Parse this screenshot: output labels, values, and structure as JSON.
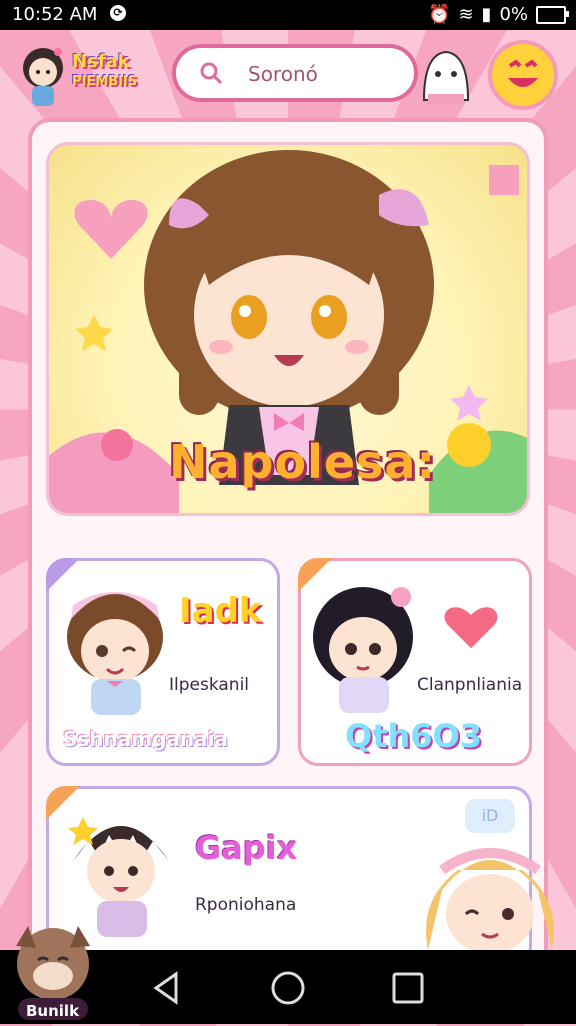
{
  "status_bar": {
    "time": "10:52 AM",
    "battery": "0%"
  },
  "header": {
    "logo_text_line1": "Nsfak",
    "logo_text_line2": "PIEMBIIS",
    "search_placeholder": "Soronó"
  },
  "hero": {
    "title": "Napolesa:"
  },
  "cards": [
    {
      "title": "Iadk",
      "subtitle": "Ilpeskanil",
      "footer": "Sshnamganaia"
    },
    {
      "title": "",
      "subtitle": "Clanpnliania",
      "footer": "Qth6O3"
    },
    {
      "title": "Gapix",
      "subtitle": "Rponiohana",
      "badge": "iD"
    }
  ],
  "fab_label": "Bunilk",
  "colors": {
    "accent_pink": "#f29abb",
    "accent_purple": "#c4a9e7",
    "accent_yellow": "#ffd13a"
  }
}
